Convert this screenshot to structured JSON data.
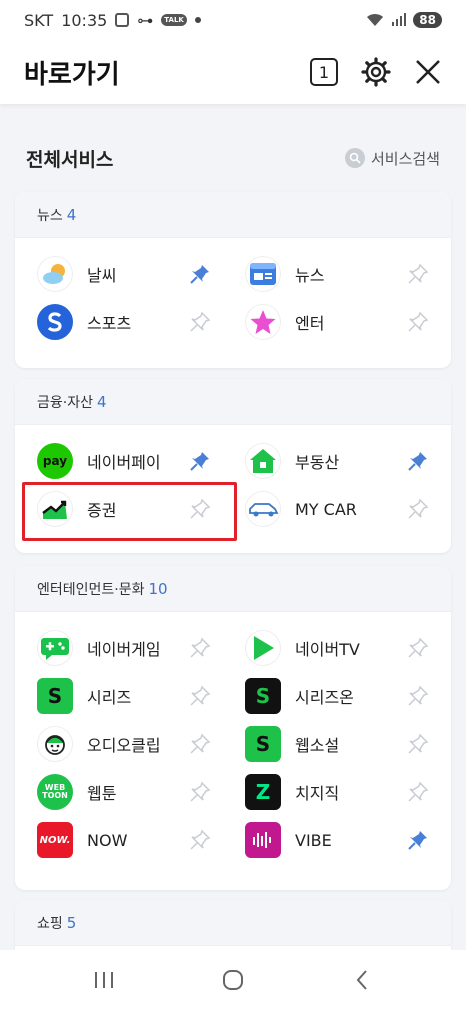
{
  "status": {
    "carrier": "SKT",
    "time": "10:35",
    "talk": "TALK",
    "battery": "88"
  },
  "header": {
    "title": "바로가기",
    "tab_count": "1"
  },
  "all_services": {
    "title": "전체서비스",
    "search_label": "서비스검색"
  },
  "colors": {
    "pin_active": "#4a7fd6",
    "pin_inactive": "#c9ccd2",
    "accent": "#3f74c6",
    "highlight": "#e0202a"
  },
  "sections": {
    "news": {
      "title": "뉴스",
      "count": "4",
      "items": [
        {
          "label": "날씨",
          "icon": "weather-icon",
          "pinned": true
        },
        {
          "label": "뉴스",
          "icon": "news-icon",
          "pinned": false
        },
        {
          "label": "스포츠",
          "icon": "sports-icon",
          "pinned": false
        },
        {
          "label": "엔터",
          "icon": "star-icon",
          "pinned": false
        }
      ]
    },
    "finance": {
      "title": "금융·자산",
      "count": "4",
      "items": [
        {
          "label": "네이버페이",
          "icon": "naverpay-icon",
          "icon_text": "pay",
          "pinned": true
        },
        {
          "label": "부동산",
          "icon": "house-icon",
          "pinned": true
        },
        {
          "label": "증권",
          "icon": "stock-chart-icon",
          "pinned": false
        },
        {
          "label": "MY CAR",
          "icon": "car-icon",
          "pinned": false
        }
      ]
    },
    "entertainment": {
      "title": "엔터테인먼트·문화",
      "count": "10",
      "items": [
        {
          "label": "네이버게임",
          "icon": "gamepad-icon",
          "pinned": false
        },
        {
          "label": "네이버TV",
          "icon": "play-icon",
          "pinned": false
        },
        {
          "label": "시리즈",
          "icon": "series-icon",
          "icon_text": "S",
          "pinned": false
        },
        {
          "label": "시리즈온",
          "icon": "series-on-icon",
          "icon_text": "S",
          "pinned": false
        },
        {
          "label": "오디오클립",
          "icon": "audioclip-icon",
          "pinned": false
        },
        {
          "label": "웹소설",
          "icon": "webnovel-icon",
          "icon_text": "S",
          "pinned": false
        },
        {
          "label": "웹툰",
          "icon": "webtoon-icon",
          "icon_text": "WEB TOON",
          "pinned": false
        },
        {
          "label": "치지직",
          "icon": "chzzk-icon",
          "icon_text": "Z",
          "pinned": false
        },
        {
          "label": "NOW",
          "icon": "now-icon",
          "icon_text": "NOW.",
          "pinned": false
        },
        {
          "label": "VIBE",
          "icon": "vibe-icon",
          "pinned": true
        }
      ]
    },
    "shopping": {
      "title": "쇼핑",
      "count": "5"
    }
  }
}
